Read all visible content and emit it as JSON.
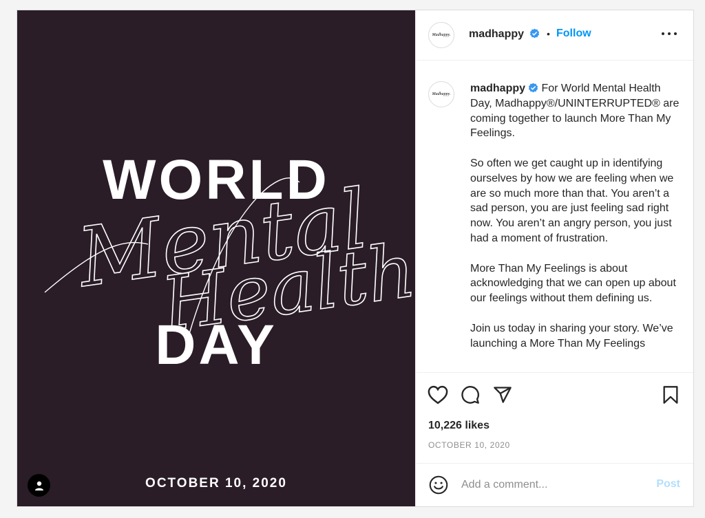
{
  "post": {
    "image": {
      "headline_top": "WORLD",
      "headline_script_1": "Mental",
      "headline_script_2": "Health",
      "headline_bottom": "DAY",
      "date_text": "OCTOBER 10, 2020",
      "background_color": "#2a1d27"
    },
    "header": {
      "avatar_text": "Madhappy.",
      "username": "madhappy",
      "verified": true,
      "separator": "•",
      "follow_label": "Follow",
      "more_icon": "more-options-icon"
    },
    "caption": {
      "username": "madhappy",
      "paragraphs": [
        "For World Mental Health Day, Madhappy®/UNINTERRUPTED® are coming together to launch More Than My Feelings.",
        "So often we get caught up in identifying ourselves by how we are feeling when we are so much more than that. You aren’t a sad person, you are just feeling sad right now. You aren’t an angry person, you just had a moment of frustration.",
        "More Than My Feelings is about acknowledging that we can open up about our feelings without them defining us.",
        "Join us today in sharing your story. We’ve launching a More Than My Feelings"
      ]
    },
    "actions": {
      "like_icon": "heart-icon",
      "comment_icon": "comment-icon",
      "share_icon": "share-icon",
      "save_icon": "bookmark-icon",
      "likes_text": "10,226 likes",
      "date_text": "OCTOBER 10, 2020"
    },
    "comment": {
      "placeholder": "Add a comment...",
      "post_label": "Post"
    },
    "colors": {
      "accent": "#0095f6",
      "post_disabled": "#b2dffc",
      "verified": "#3897f0"
    }
  }
}
